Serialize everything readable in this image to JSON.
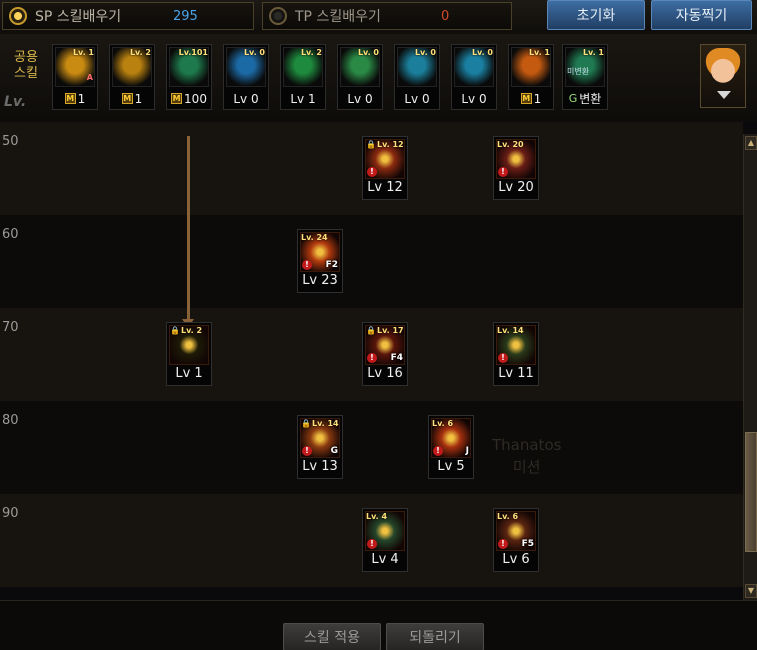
{
  "header": {
    "sp_mode": {
      "label": "SP 스킬배우기",
      "value": "295"
    },
    "tp_mode": {
      "label": "TP 스킬배우기",
      "value": "0"
    },
    "reset_label": "초기화",
    "auto_label": "자동찍기"
  },
  "shared": {
    "label_line1": "공용",
    "label_line2": "스킬",
    "faded_text": "Lv.",
    "skills": [
      {
        "badge": "Lv. 1",
        "level": "1",
        "m_mark": "M",
        "tag": "A",
        "icon": "fist-icon",
        "color": "#c98b12"
      },
      {
        "badge": "Lv. 2",
        "level": "1",
        "m_mark": "M",
        "icon": "kick-icon",
        "color": "#b9810f"
      },
      {
        "badge": "Lv.101",
        "level": "100",
        "m_mark": "M",
        "icon": "run-icon",
        "color": "#1e7a4c"
      },
      {
        "badge": "Lv. 0",
        "level": "Lv 0",
        "icon": "wings-icon",
        "color": "#1c6aa5"
      },
      {
        "badge": "Lv. 2",
        "level": "Lv 1",
        "icon": "crosshair-icon",
        "color": "#1e8a3e"
      },
      {
        "badge": "Lv. 0",
        "level": "Lv 0",
        "icon": "leap-icon",
        "color": "#2a8a45"
      },
      {
        "badge": "Lv. 0",
        "level": "Lv 0",
        "icon": "eye-icon",
        "color": "#1b7e9a"
      },
      {
        "badge": "Lv. 0",
        "level": "Lv 0",
        "icon": "body-icon",
        "color": "#1a7fa0"
      },
      {
        "badge": "Lv. 1",
        "level": "1",
        "m_mark": "M",
        "icon": "flame-icon",
        "color": "#c45a10"
      },
      {
        "badge": "Lv. 1",
        "level": "변환",
        "extra": "미변환",
        "swap": "G",
        "icon": "rune-icon",
        "color": "#1f7a52"
      }
    ]
  },
  "tree": {
    "rows": [
      {
        "label": "50"
      },
      {
        "label": "60"
      },
      {
        "label": "70"
      },
      {
        "label": "80"
      },
      {
        "label": "90"
      }
    ],
    "watermark_line1": "Thanatos",
    "watermark_line2": "미션",
    "skills": [
      {
        "row": 0,
        "col": "c3",
        "badge": "Lv. 12",
        "level": "Lv 12",
        "lock": true,
        "warn": true,
        "icon": "swarm-icon",
        "color": "#8a2a10"
      },
      {
        "row": 0,
        "col": "c5",
        "badge": "Lv. 20",
        "level": "Lv 20",
        "warn": true,
        "icon": "claw-icon",
        "color": "#6a1d16"
      },
      {
        "row": 1,
        "col": "c2",
        "badge": "Lv. 24",
        "level": "Lv 23",
        "hotkey": "F2",
        "warn": true,
        "icon": "burst-icon",
        "color": "#b13a0e"
      },
      {
        "row": 2,
        "col": "c1",
        "badge": "Lv. 2",
        "level": "Lv 1",
        "lock": true,
        "icon": "aura-icon",
        "color": "#1d1a06"
      },
      {
        "row": 2,
        "col": "c3",
        "badge": "Lv. 17",
        "level": "Lv 16",
        "hotkey": "F4",
        "lock": true,
        "warn": true,
        "icon": "web-icon",
        "color": "#5a150b"
      },
      {
        "row": 2,
        "col": "c5",
        "badge": "Lv. 14",
        "level": "Lv 11",
        "warn": true,
        "icon": "beast-icon",
        "color": "#2a3a1a"
      },
      {
        "row": 3,
        "col": "c2",
        "badge": "Lv. 14",
        "level": "Lv 13",
        "hotkey": "G",
        "lock": true,
        "warn": true,
        "icon": "wing-slash-icon",
        "color": "#8a3a10"
      },
      {
        "row": 3,
        "col": "c4",
        "badge": "Lv. 6",
        "level": "Lv 5",
        "hotkey": "J",
        "warn": true,
        "icon": "fire-spin-icon",
        "color": "#a4300e"
      },
      {
        "row": 4,
        "col": "c3",
        "badge": "Lv. 4",
        "level": "Lv 4",
        "warn": true,
        "icon": "poison-icon",
        "color": "#24462a"
      },
      {
        "row": 4,
        "col": "c5",
        "badge": "Lv. 6",
        "level": "Lv 6",
        "hotkey": "F5",
        "warn": true,
        "icon": "demon-icon",
        "color": "#5a2410"
      }
    ]
  },
  "footer": {
    "apply_label": "스킬 적용",
    "undo_label": "되돌리기"
  },
  "scrollbar": {
    "up": "▲",
    "down": "▼"
  }
}
